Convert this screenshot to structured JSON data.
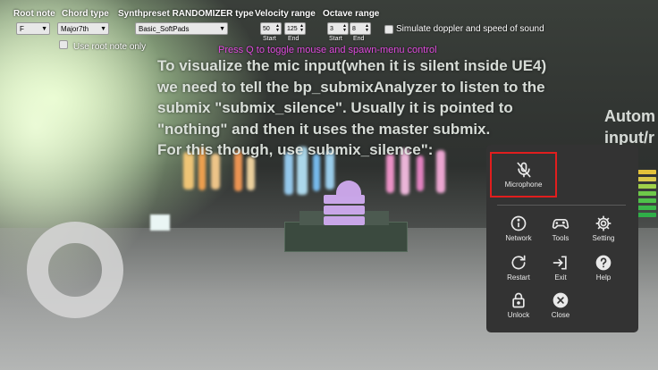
{
  "toolbar": {
    "root_note": {
      "label": "Root note",
      "value": "F"
    },
    "chord_type": {
      "label": "Chord type",
      "value": "Major7th"
    },
    "synthpreset": {
      "label": "Synthpreset RANDOMIZER type",
      "value": "Basic_SoftPads"
    },
    "velocity_range": {
      "label": "Velocity range",
      "start": "50",
      "end": "125",
      "start_label": "Start",
      "end_label": "End"
    },
    "octave_range": {
      "label": "Octave range",
      "start": "3",
      "end": "8",
      "start_label": "Start",
      "end_label": "End"
    },
    "simulate_doppler": {
      "label": "Simulate doppler and speed of sound",
      "checked": false
    },
    "use_root_note_only": {
      "label": "Use root note only",
      "checked": false
    }
  },
  "hint": "Press Q to toggle mouse and spawn-menu control",
  "paragraph": [
    "To visualize the mic input(when it  is silent inside UE4)",
    "we need to tell the bp_submixAnalyzer to listen to the",
    " submix \"submix_silence\". Usually it is pointed to",
    "\"nothing\" and then it uses the master submix.",
    "For this though, use submix_silence\":"
  ],
  "right_sign": [
    "Autom",
    "input/r"
  ],
  "menu": {
    "microphone": {
      "label": "Microphone",
      "icon": "microphone-muted-icon"
    },
    "items": [
      {
        "label": "Network",
        "icon": "info-icon"
      },
      {
        "label": "Tools",
        "icon": "gamepad-icon"
      },
      {
        "label": "Setting",
        "icon": "gear-icon"
      },
      {
        "label": "Restart",
        "icon": "restart-icon"
      },
      {
        "label": "Exit",
        "icon": "exit-icon"
      },
      {
        "label": "Help",
        "icon": "help-icon"
      },
      {
        "label": "Unlock",
        "icon": "lock-icon"
      },
      {
        "label": "Close",
        "icon": "close-icon"
      }
    ],
    "highlight_color": "#e11e1e",
    "panel_color": "#333333"
  },
  "colors": {
    "hint": "#e24de0",
    "paragraph": "#e6ece6"
  }
}
